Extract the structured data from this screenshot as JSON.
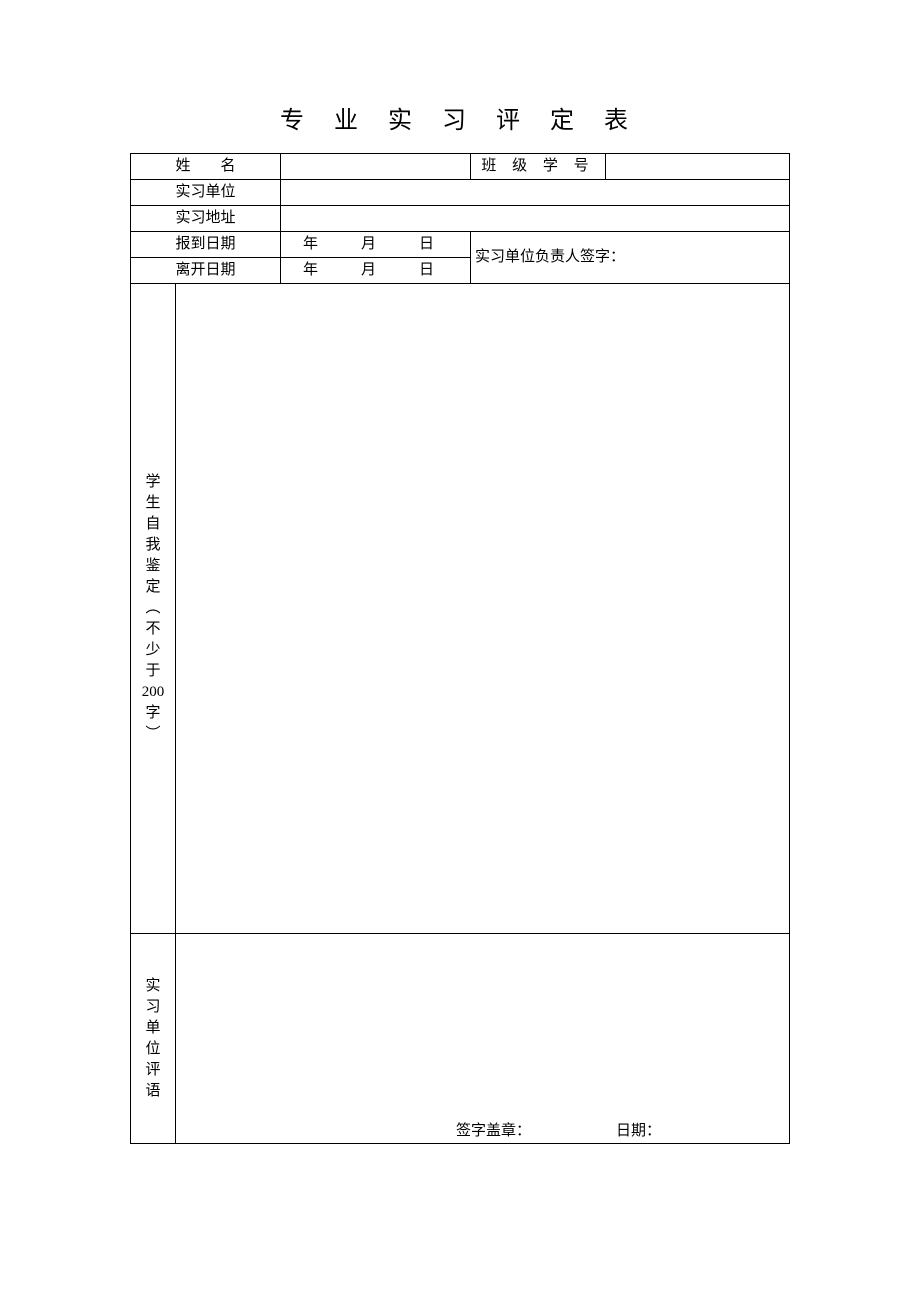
{
  "title": "专 业 实 习 评 定 表",
  "labels": {
    "name": "姓　　名",
    "class_no": "班 级 学 号",
    "unit": "实习单位",
    "address": "实习地址",
    "report_date": "报到日期",
    "leave_date": "离开日期",
    "date_format": "年　月　日",
    "supervisor_sign": "实习单位负责人签字：",
    "self_eval_chars": [
      "学",
      "生",
      "自",
      "我",
      "鉴",
      "定",
      "︵",
      "不",
      "少",
      "于",
      "200",
      "字",
      "︶"
    ],
    "unit_comment_chars": [
      "实",
      "习",
      "单",
      "位",
      "评",
      "语"
    ],
    "sign_seal": "签字盖章：",
    "date": "日期："
  }
}
